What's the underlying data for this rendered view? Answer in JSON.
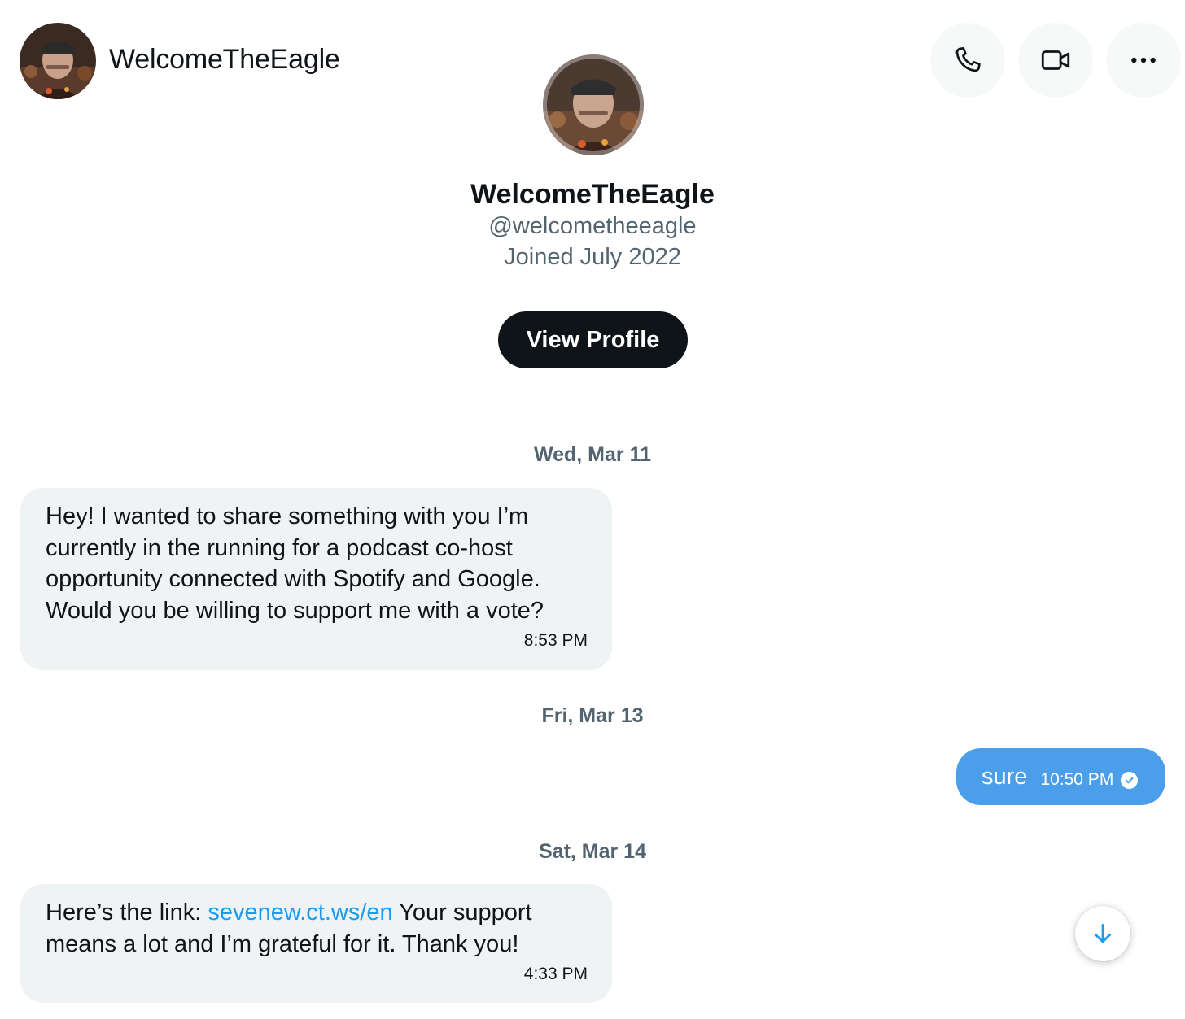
{
  "header": {
    "name": "WelcomeTheEagle",
    "avatar_icon": "profile-photo",
    "actions": [
      {
        "icon": "phone-icon"
      },
      {
        "icon": "video-icon"
      },
      {
        "icon": "more-icon"
      }
    ]
  },
  "profile": {
    "name": "WelcomeTheEagle",
    "handle": "@welcometheeagle",
    "joined": "Joined July 2022",
    "view_profile_label": "View Profile"
  },
  "conversation": {
    "date1": "Wed, Mar 11",
    "msg1": {
      "text": "Hey! I wanted to share something with you I’m currently in the running for a podcast co-host opportunity connected with Spotify and Google. Would you be willing to support me with a vote?",
      "time": "8:53 PM"
    },
    "date2": "Fri, Mar 13",
    "msg2": {
      "text": "sure",
      "time": "10:50 PM"
    },
    "date3": "Sat, Mar 14",
    "msg3": {
      "prefix": "Here’s the link: ",
      "link": "sevenew.ct.ws/en",
      "suffix": " Your support means a lot and I’m grateful for it. Thank you!",
      "time": "4:33 PM"
    }
  },
  "colors": {
    "accent": "#1d9bf0",
    "sent_bubble": "#4b9eea",
    "received_bubble": "#eff3f4",
    "primary_button": "#0f1419",
    "muted_text": "#536471"
  },
  "scroll_button_icon": "arrow-down-icon"
}
